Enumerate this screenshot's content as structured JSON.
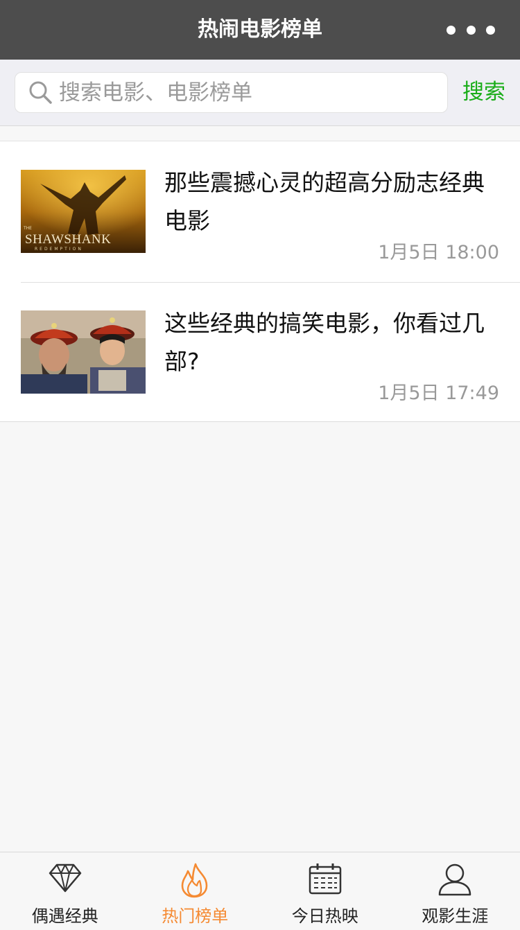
{
  "header": {
    "title": "热闹电影榜单",
    "more_icon": "more-dots-icon"
  },
  "search": {
    "placeholder": "搜索电影、电影榜单",
    "value": "",
    "button_label": "搜索"
  },
  "articles": [
    {
      "title": "那些震撼心灵的超高分励志经典电影",
      "time": "1月5日 18:00",
      "thumb_text": "SHAWSHANK",
      "thumb_subtext": "REDEMPTION",
      "thumb_small": "THE"
    },
    {
      "title": "这些经典的搞笑电影，你看过几部?",
      "time": "1月5日 17:49"
    }
  ],
  "tabbar": {
    "tabs": [
      {
        "label": "偶遇经典",
        "icon": "diamond-icon"
      },
      {
        "label": "热门榜单",
        "icon": "flame-icon",
        "active": true
      },
      {
        "label": "今日热映",
        "icon": "calendar-icon"
      },
      {
        "label": "观影生涯",
        "icon": "user-icon"
      }
    ]
  },
  "colors": {
    "accent_green": "#1aad19",
    "accent_orange": "#f58a32",
    "titlebar": "#4d4d4d"
  }
}
